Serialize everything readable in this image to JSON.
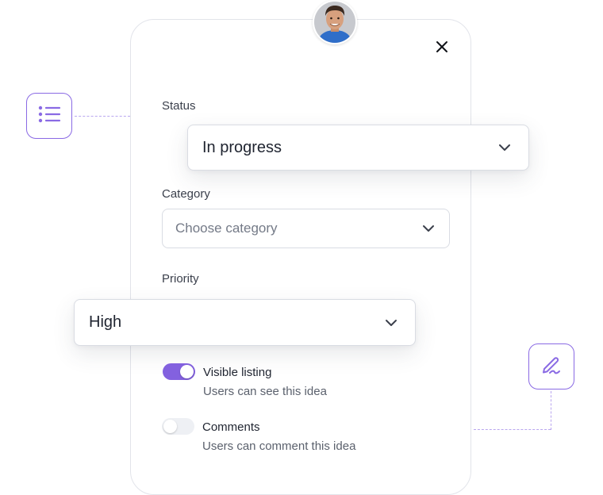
{
  "status": {
    "label": "Status",
    "value": "In progress"
  },
  "category": {
    "label": "Category",
    "placeholder": "Choose category"
  },
  "priority": {
    "label": "Priority",
    "value": "High"
  },
  "options": [
    {
      "title": "Visible listing",
      "description": "Users can see this idea",
      "enabled": true
    },
    {
      "title": "Comments",
      "description": "Users can comment this idea",
      "enabled": false
    }
  ],
  "icons": {
    "close": "close-icon",
    "list": "list-icon",
    "signature": "pen-signature-icon",
    "chevron": "chevron-down-icon",
    "avatar": "user-avatar"
  },
  "colors": {
    "accent": "#8361df",
    "border": "#d9dce3",
    "toggle_off": "#eef0f4"
  }
}
